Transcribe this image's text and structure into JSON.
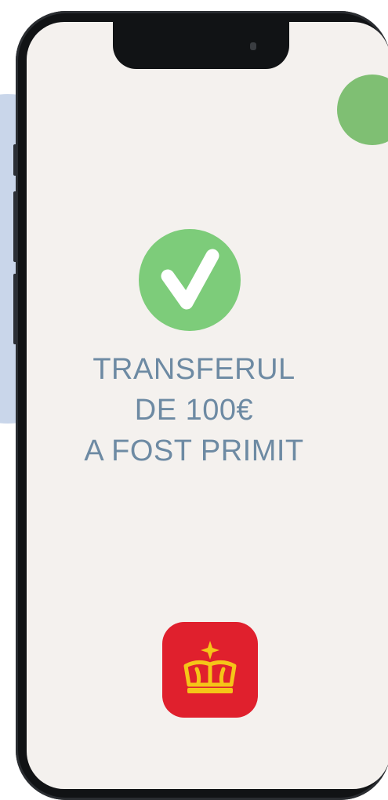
{
  "message": {
    "line1": "TRANSFERUL",
    "line2": "DE 100€",
    "line3": "A FOST PRIMIT"
  },
  "icons": {
    "success": "check-icon",
    "app": "crown-logo"
  },
  "colors": {
    "screen_background": "#f4f1ee",
    "success_green": "#7dcc7a",
    "message_text": "#6d8aa3",
    "app_red": "#e0202d",
    "crown_yellow": "#f5c518"
  }
}
